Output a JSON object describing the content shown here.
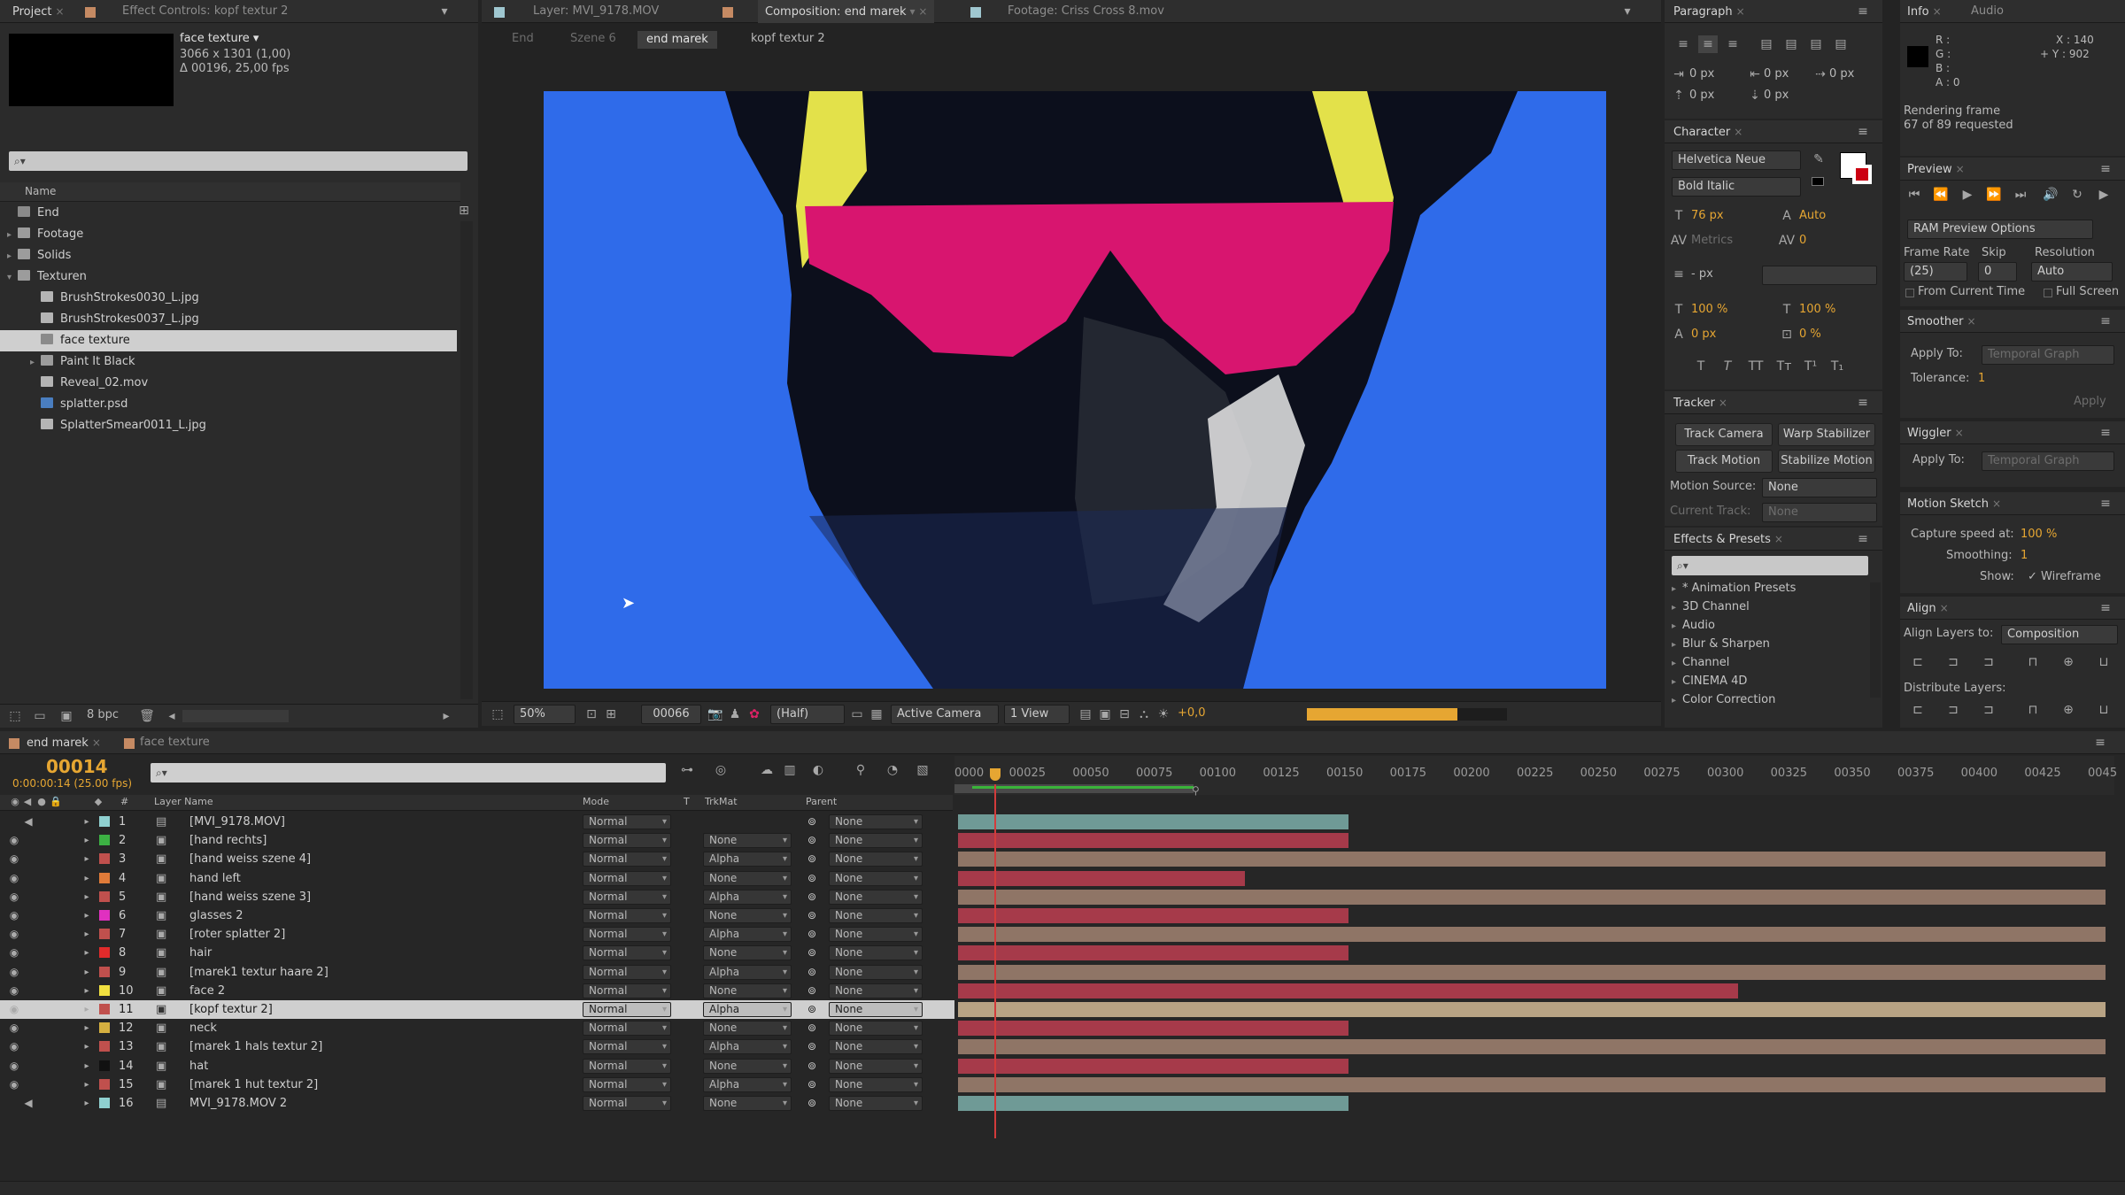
{
  "project": {
    "tab_project": "Project",
    "tab_effect_controls": "Effect Controls: kopf textur 2",
    "selected_name": "face texture ▾",
    "selected_size": "3066 x 1301 (1,00)",
    "selected_duration": "Δ 00196, 25,00 fps",
    "search_placeholder": "⌕▾",
    "col_name": "Name",
    "items": [
      {
        "label": "End",
        "type": "comp",
        "indent": 0
      },
      {
        "label": "Footage",
        "type": "folder",
        "indent": 0
      },
      {
        "label": "Solids",
        "type": "folder",
        "indent": 0
      },
      {
        "label": "Texturen",
        "type": "folder-open",
        "indent": 0
      },
      {
        "label": "BrushStrokes0030_L.jpg",
        "type": "file",
        "indent": 1
      },
      {
        "label": "BrushStrokes0037_L.jpg",
        "type": "file",
        "indent": 1
      },
      {
        "label": "face texture",
        "type": "comp",
        "indent": 1,
        "selected": true
      },
      {
        "label": "Paint It Black",
        "type": "folder",
        "indent": 1
      },
      {
        "label": "Reveal_02.mov",
        "type": "file",
        "indent": 1
      },
      {
        "label": "splatter.psd",
        "type": "psd",
        "indent": 1
      },
      {
        "label": "SplatterSmear0011_L.jpg",
        "type": "file",
        "indent": 1
      }
    ],
    "bpc": "8 bpc"
  },
  "viewer": {
    "tabs": [
      "Layer: MVI_9178.MOV",
      "Composition: end marek",
      "Footage: Criss Cross 8.mov"
    ],
    "breadcrumbs": [
      "End",
      "Szene 6",
      "end marek",
      "kopf textur 2"
    ],
    "zoom": "50%",
    "frame": "00066",
    "resolution": "(Half)",
    "camera": "Active Camera",
    "views": "1 View",
    "exposure": "+0,0"
  },
  "paragraph": {
    "tab": "Paragraph",
    "indent_left": "0 px",
    "indent_right": "0 px",
    "space_before": "0 px",
    "first_indent": "0 px",
    "space_after": "0 px",
    "space_after2": "0 px"
  },
  "character": {
    "tab": "Character",
    "font": "Helvetica Neue",
    "style": "Bold Italic",
    "size": "76 px",
    "leading": "Auto",
    "kerning": "Metrics",
    "tracking": "0",
    "stroke": "- px",
    "vscale": "100 %",
    "hscale": "100 %",
    "baseline": "0 px",
    "tsume": "0 %",
    "formats": [
      "T",
      "T",
      "TT",
      "Tт",
      "T¹",
      "T₁"
    ]
  },
  "tracker": {
    "tab": "Tracker",
    "track_camera": "Track Camera",
    "warp_stabilizer": "Warp Stabilizer",
    "track_motion": "Track Motion",
    "stabilize_motion": "Stabilize Motion",
    "motion_source_label": "Motion Source:",
    "motion_source": "None",
    "current_track_label": "Current Track:",
    "current_track": "None"
  },
  "effects": {
    "tab": "Effects & Presets",
    "items": [
      "* Animation Presets",
      "3D Channel",
      "Audio",
      "Blur & Sharpen",
      "Channel",
      "CINEMA 4D",
      "Color Correction"
    ]
  },
  "info": {
    "tab_info": "Info",
    "tab_audio": "Audio",
    "r": "R :",
    "g": "G :",
    "b": "B :",
    "a": "A : 0",
    "x": "X : 140",
    "y": "+ Y : 902",
    "rendering": "Rendering frame",
    "progress": "67 of 89 requested"
  },
  "preview": {
    "tab": "Preview",
    "options": "RAM Preview Options",
    "frame_rate_label": "Frame Rate",
    "skip_label": "Skip",
    "resolution_label": "Resolution",
    "frame_rate": "(25)",
    "skip": "0",
    "resolution": "Auto",
    "from_current": "From Current Time",
    "full_screen": "Full Screen"
  },
  "smoother": {
    "tab": "Smoother",
    "apply_to_label": "Apply To:",
    "apply_to": "Temporal Graph",
    "tolerance_label": "Tolerance:",
    "tolerance": "1",
    "apply": "Apply"
  },
  "wiggler": {
    "tab": "Wiggler",
    "apply_to_label": "Apply To:",
    "apply_to": "Temporal Graph"
  },
  "motion_sketch": {
    "tab": "Motion Sketch",
    "capture_label": "Capture speed at:",
    "capture": "100 %",
    "smoothing_label": "Smoothing:",
    "smoothing": "1",
    "show_label": "Show:",
    "wireframe": "✓ Wireframe"
  },
  "align": {
    "tab": "Align",
    "align_to_label": "Align Layers to:",
    "align_to": "Composition",
    "distribute_label": "Distribute Layers:"
  },
  "timeline": {
    "tabs": [
      "end marek",
      "face texture"
    ],
    "timecode": "00014",
    "timecode_sub": "0:00:00:14 (25.00 fps)",
    "search_placeholder": "⌕▾",
    "headers": {
      "num": "#",
      "name": "Layer Name",
      "mode": "Mode",
      "t": "T",
      "trkmat": "TrkMat",
      "parent": "Parent"
    },
    "ruler": [
      "0000",
      "00025",
      "00050",
      "00075",
      "00100",
      "00125",
      "00150",
      "00175",
      "00200",
      "00225",
      "00250",
      "00275",
      "00300",
      "00325",
      "00350",
      "00375",
      "00400",
      "00425",
      "0045"
    ],
    "layers": [
      {
        "num": "1",
        "name": "[MVI_9178.MOV]",
        "color": "#8fd0d0",
        "mode": "Normal",
        "trkmat": "",
        "parent": "None",
        "bar_end": 0.34,
        "bar_color": "#6f9a96",
        "audio": true
      },
      {
        "num": "2",
        "name": "[hand rechts]",
        "color": "#3cb043",
        "mode": "Normal",
        "trkmat": "None",
        "parent": "None",
        "bar_end": 0.34,
        "bar_color": "#a63a4a"
      },
      {
        "num": "3",
        "name": "[hand weiss szene 4]",
        "color": "#c0504d",
        "mode": "Normal",
        "trkmat": "Alpha",
        "parent": "None",
        "bar_end": 1.0,
        "bar_color": "#8f7566"
      },
      {
        "num": "4",
        "name": "hand left",
        "color": "#e07b39",
        "mode": "Normal",
        "trkmat": "None",
        "parent": "None",
        "bar_end": 0.25,
        "bar_color": "#a63a4a"
      },
      {
        "num": "5",
        "name": "[hand weiss szene 3]",
        "color": "#c0504d",
        "mode": "Normal",
        "trkmat": "Alpha",
        "parent": "None",
        "bar_end": 1.0,
        "bar_color": "#8f7566"
      },
      {
        "num": "6",
        "name": "glasses 2",
        "color": "#e030c0",
        "mode": "Normal",
        "trkmat": "None",
        "parent": "None",
        "bar_end": 0.34,
        "bar_color": "#a63a4a"
      },
      {
        "num": "7",
        "name": "[roter splatter 2]",
        "color": "#c0504d",
        "mode": "Normal",
        "trkmat": "Alpha",
        "parent": "None",
        "bar_end": 1.0,
        "bar_color": "#8f7566"
      },
      {
        "num": "8",
        "name": "hair",
        "color": "#e02b2b",
        "mode": "Normal",
        "trkmat": "None",
        "parent": "None",
        "bar_end": 0.34,
        "bar_color": "#a63a4a"
      },
      {
        "num": "9",
        "name": "[marek1 textur haare 2]",
        "color": "#c0504d",
        "mode": "Normal",
        "trkmat": "Alpha",
        "parent": "None",
        "bar_end": 1.0,
        "bar_color": "#8f7566"
      },
      {
        "num": "10",
        "name": "face 2",
        "color": "#f0e040",
        "mode": "Normal",
        "trkmat": "None",
        "parent": "None",
        "bar_end": 0.68,
        "bar_color": "#a63a4a"
      },
      {
        "num": "11",
        "name": "[kopf textur 2]",
        "color": "#c0504d",
        "mode": "Normal",
        "trkmat": "Alpha",
        "parent": "None",
        "bar_end": 1.0,
        "bar_color": "#b8a384",
        "selected": true
      },
      {
        "num": "12",
        "name": "neck",
        "color": "#d6b040",
        "mode": "Normal",
        "trkmat": "None",
        "parent": "None",
        "bar_end": 0.34,
        "bar_color": "#a63a4a"
      },
      {
        "num": "13",
        "name": "[marek 1 hals textur 2]",
        "color": "#c0504d",
        "mode": "Normal",
        "trkmat": "Alpha",
        "parent": "None",
        "bar_end": 1.0,
        "bar_color": "#8f7566"
      },
      {
        "num": "14",
        "name": "hat",
        "color": "#111111",
        "mode": "Normal",
        "trkmat": "None",
        "parent": "None",
        "bar_end": 0.34,
        "bar_color": "#a63a4a"
      },
      {
        "num": "15",
        "name": "[marek 1 hut textur 2]",
        "color": "#c0504d",
        "mode": "Normal",
        "trkmat": "Alpha",
        "parent": "None",
        "bar_end": 1.0,
        "bar_color": "#8f7566"
      },
      {
        "num": "16",
        "name": "MVI_9178.MOV 2",
        "color": "#8fd0d0",
        "mode": "Normal",
        "trkmat": "None",
        "parent": "None",
        "bar_end": 0.34,
        "bar_color": "#6f9a96",
        "audio": true
      }
    ]
  },
  "colors": {
    "accent": "#e6a632",
    "comp_bg": "#2f6bea",
    "glasses": "#d8156f",
    "playhead": "#d23b3b"
  }
}
